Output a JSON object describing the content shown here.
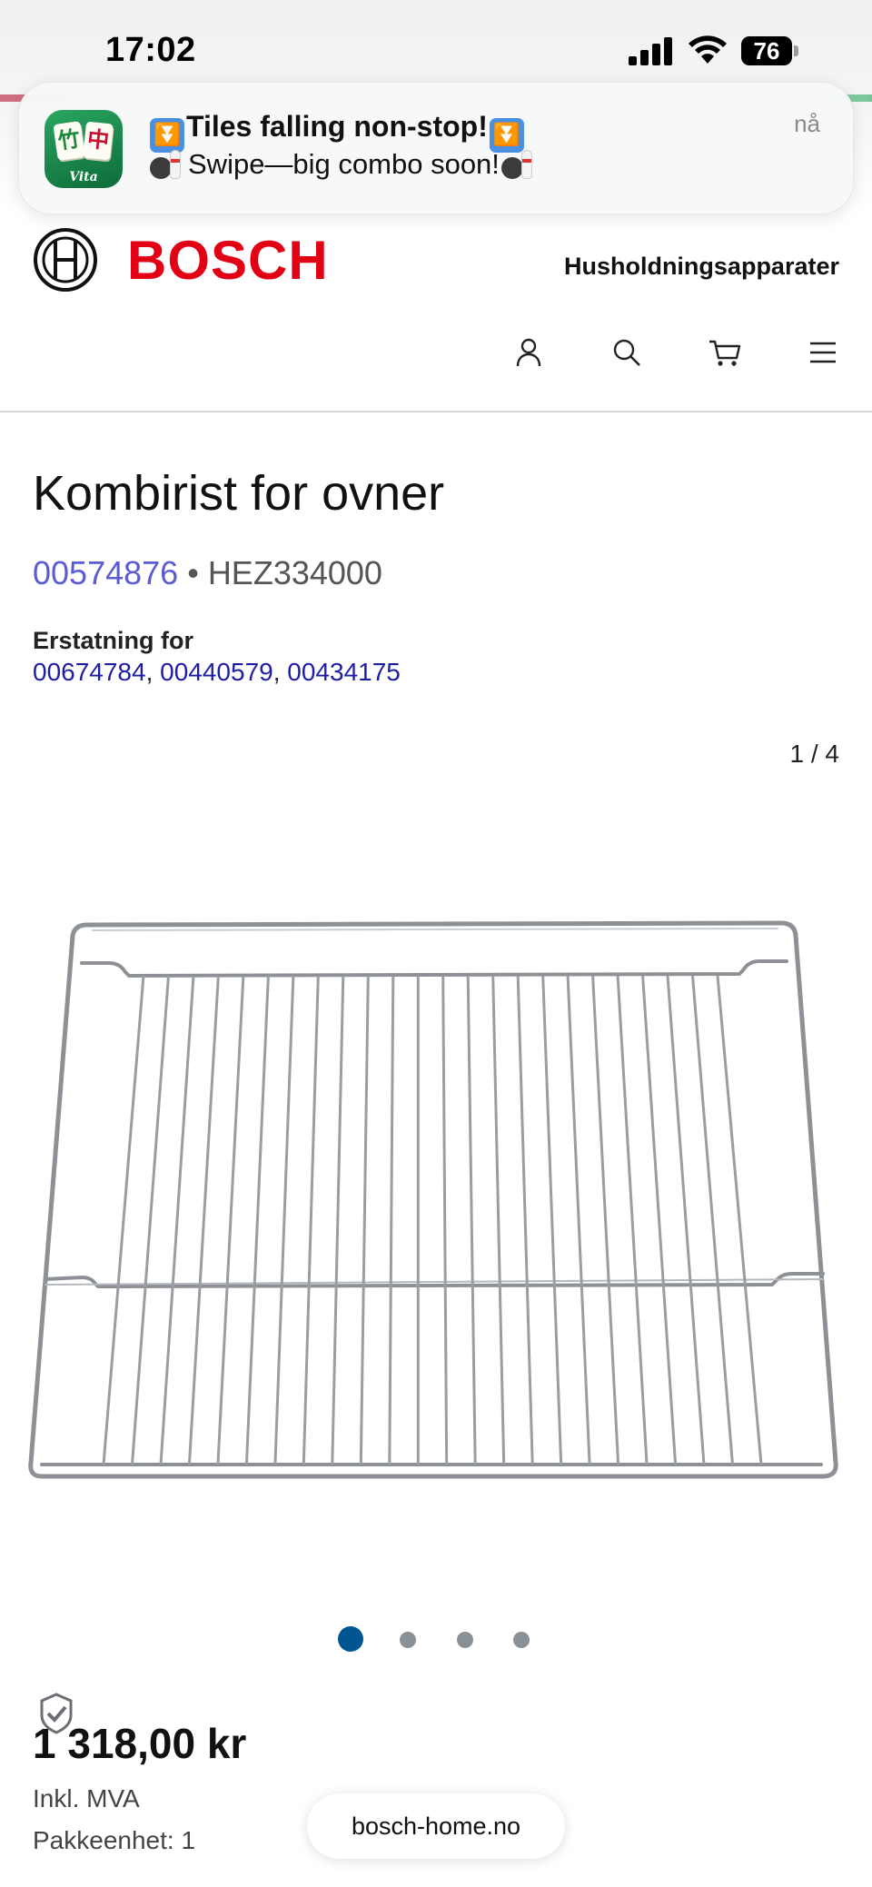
{
  "status_bar": {
    "time": "17:02",
    "battery": "76"
  },
  "notification": {
    "line1": "Tiles falling non-stop!",
    "line2": "Swipe—big combo soon!",
    "time": "nå",
    "app_icon_label": "Vita"
  },
  "header": {
    "brand": "BOSCH",
    "category": "Husholdningsapparater",
    "icons": [
      "account-icon",
      "search-icon",
      "cart-icon",
      "menu-icon"
    ],
    "brand_color": "#e20015"
  },
  "product": {
    "title": "Kombirist for ovner",
    "part_number": "00574876",
    "separator": "•",
    "model": "HEZ334000",
    "replacement_label": "Erstatning for",
    "replacements": [
      "00674784",
      "00440579",
      "00434175"
    ],
    "gallery_counter": "1 / 4",
    "gallery_total": 4,
    "gallery_active": 1,
    "price": "1 318,00 kr",
    "vat_note": "Inkl. MVA",
    "pack_unit": "Pakkeenhet: 1"
  },
  "browser": {
    "url": "bosch-home.no"
  },
  "colors": {
    "accent_blue": "#005691",
    "link_blue": "#1d1da6",
    "part_number_color": "#5b5bd6"
  }
}
